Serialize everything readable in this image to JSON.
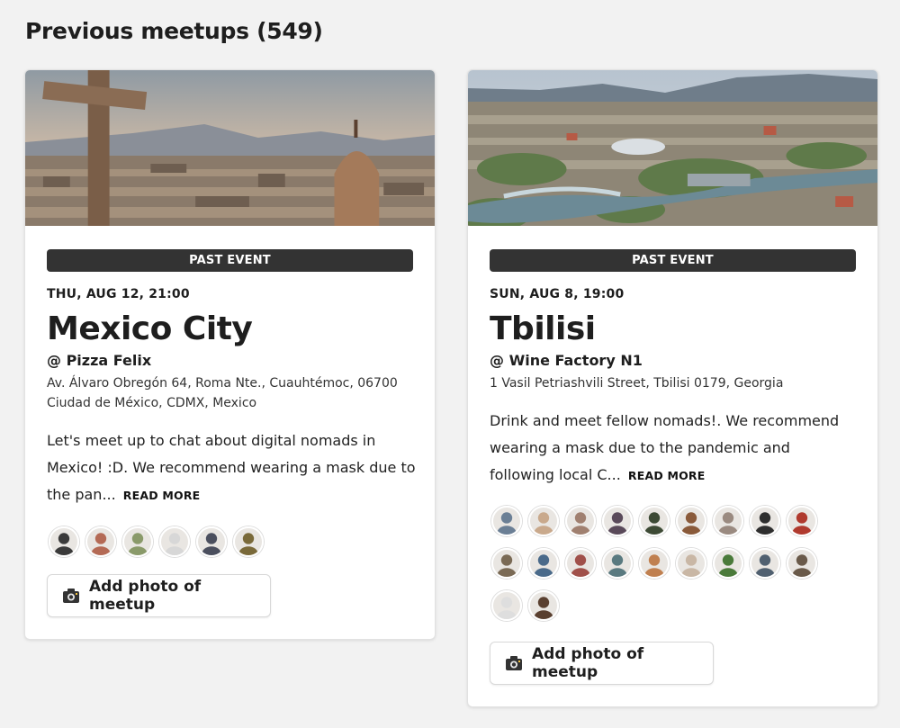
{
  "page": {
    "heading": "Previous meetups (549)"
  },
  "meetups": [
    {
      "badge": "PAST EVENT",
      "date": "THU, AUG 12, 21:00",
      "city": "Mexico City",
      "venue": "@ Pizza Felix",
      "address": "Av. Álvaro Obregón 64, Roma Nte., Cuauhtémoc, 06700 Ciudad de México, CDMX, Mexico",
      "description": "Let's meet up to chat about digital nomads in Mexico! :D. We recommend wearing a mask due to the pan...",
      "read_more": "READ MORE",
      "add_photo": "Add photo of meetup",
      "attendee_colors": [
        "#3a3a3a",
        "#b46a55",
        "#8a9a6a",
        "#d7d7d7",
        "#4b4f5e",
        "#7a6a3a"
      ]
    },
    {
      "badge": "PAST EVENT",
      "date": "SUN, AUG 8, 19:00",
      "city": "Tbilisi",
      "venue": "@ Wine Factory N1",
      "address": "1 Vasil Petriashvili Street, Tbilisi 0179, Georgia",
      "description": "Drink and meet fellow nomads!. We recommend wearing a mask due to the pandemic and following local C...",
      "read_more": "READ MORE",
      "add_photo": "Add photo of meetup",
      "attendee_colors": [
        "#6b7f95",
        "#c9a98c",
        "#a08070",
        "#5a4a5a",
        "#3d4a35",
        "#8a5a3a",
        "#9a8a80",
        "#2e2e2e",
        "#b03a2e",
        "#7a6a55",
        "#4a6a8a",
        "#a0504a",
        "#5a7a80",
        "#c08050",
        "#c9b7a5",
        "#4a7a3a",
        "#506070",
        "#6a5a4a",
        "#dedede",
        "#5a4030"
      ]
    }
  ]
}
